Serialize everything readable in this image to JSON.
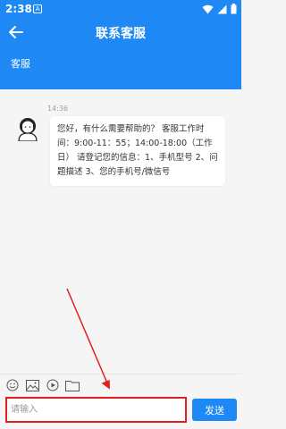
{
  "status_bar": {
    "time": "2:38",
    "notification_badge": "A"
  },
  "header": {
    "title": "联系客服"
  },
  "subheader": {
    "label": "客服"
  },
  "chat": {
    "timestamp": "14:36",
    "message": "您好，有什么需要帮助的？ 客服工作时间：9:00-11：55；14:00-18:00（工作日） 请登记您的信息：1、手机型号 2、问题描述 3、您的手机号/微信号"
  },
  "toolbar": {
    "icons": [
      "emoji-icon",
      "image-icon",
      "video-icon",
      "folder-icon"
    ]
  },
  "input": {
    "placeholder": "请输入",
    "value": ""
  },
  "send_button": {
    "label": "发送"
  },
  "colors": {
    "primary": "#1e88f5",
    "highlight": "#e02020"
  }
}
